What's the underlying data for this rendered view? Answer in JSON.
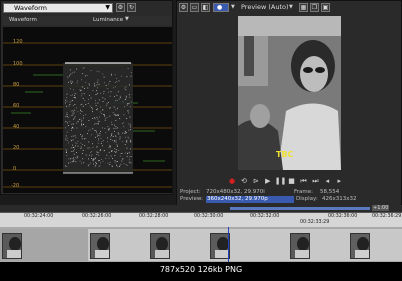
{
  "scope": {
    "mode": "Waveform",
    "header_left": "Waveform",
    "header_right": "Luminance",
    "scale_labels": [
      "120",
      "100",
      "80",
      "60",
      "40",
      "20",
      "0",
      "-20"
    ]
  },
  "preview": {
    "mode_label": "Preview (Auto)",
    "overlay_text": "TBC",
    "info": {
      "project_label": "Project:",
      "project_value": "720x480x32, 29.970i",
      "preview_label": "Preview:",
      "preview_value": "360x240x32, 29.970p",
      "frame_label": "Frame:",
      "frame_value": "58,554",
      "display_label": "Display:",
      "display_value": "426x313x32"
    }
  },
  "timeline": {
    "ruler_labels": [
      "00:32:24:00",
      "00:32:26:00",
      "00:32:28:00",
      "00:32:30:00",
      "00:32:32:00",
      "00:32:33:29",
      "00:32:36:00",
      "00:32:36:29"
    ],
    "marker": "+1:00"
  },
  "status_text": "787x520  126kb  PNG",
  "colors": {
    "scale_line": "#b07a10",
    "green_marks": "#3a8a2a",
    "accent": "#3a5ab0"
  }
}
